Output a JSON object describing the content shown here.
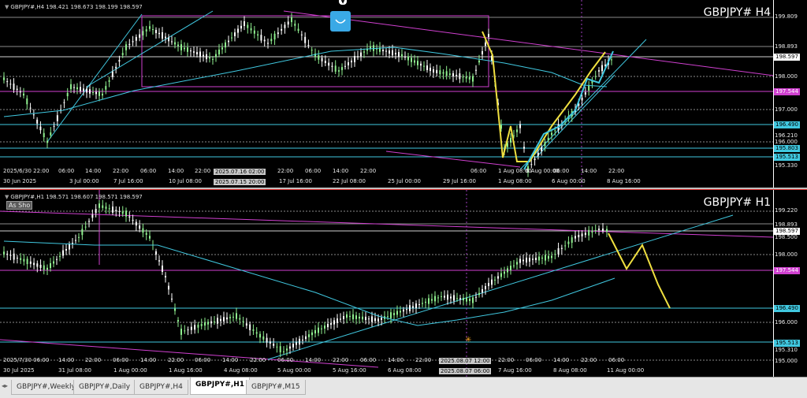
{
  "h4": {
    "info": "GBPJPY#,H4  198.421 198.673 198.199 198.597",
    "tf": "GBPJPY# H4",
    "prices": [
      "199.809",
      "198.893",
      "198.597",
      "198.000",
      "197.544",
      "197.000",
      "196.490",
      "196.210",
      "196.000",
      "195.803",
      "195.513",
      "195.330"
    ],
    "times": [
      "2025/6/30 22:00",
      "06:00",
      "14:00",
      "22:00",
      "06:00",
      "14:00",
      "22:00",
      "2025.07.16 02:00",
      "22:00",
      "06:00",
      "14:00",
      "22:00",
      "06:00",
      "1 Aug 08:00",
      "6 Aug 00:00",
      "06:00",
      "14:00",
      "22:00"
    ],
    "time_labels": [
      "30 Jun 2025",
      "3 Jul 00:00",
      "7 Jul 16:00",
      "10 Jul 08:00",
      "2025.07.15 20:00",
      "17 Jul 16:00",
      "22 Jul 08:00",
      "25 Jul 00:00",
      "29 Jul 16:00",
      "1 Aug 08:00",
      "6 Aug 00:00",
      "8 Aug 16:00"
    ]
  },
  "h1": {
    "info": "GBPJPY#,H1  198.571 198.607 198.571 198.597",
    "tf": "GBPJPY# H1",
    "as_show": "As Sho",
    "prices": [
      "199.220",
      "198.893",
      "198.597",
      "198.500",
      "198.000",
      "197.544",
      "196.490",
      "196.000",
      "195.513",
      "195.310",
      "195.000"
    ],
    "times": [
      "2025/7/30 06:00",
      "14:00",
      "22:00",
      "06:00",
      "14:00",
      "22:00",
      "06:00",
      "14:00",
      "22:00",
      "06:00",
      "14:00",
      "22:00",
      "06:00",
      "14:00",
      "22:00",
      "2025.08.07 12:00",
      "22:00",
      "06:00",
      "14:00",
      "22:00",
      "06:00"
    ],
    "time_labels": [
      "30 Jul 2025",
      "31 Jul 08:00",
      "1 Aug 00:00",
      "1 Aug 16:00",
      "4 Aug 08:00",
      "5 Aug 00:00",
      "5 Aug 16:00",
      "6 Aug 08:00",
      "2025.08.07 06:00",
      "7 Aug 16:00",
      "8 Aug 08:00",
      "11 Aug 00:00"
    ]
  },
  "tabs": [
    "GBPJPY#,Weekly",
    "GBPJPY#,Daily",
    "GBPJPY#,H4",
    "GBPJPY#,H1",
    "GBPJPY#,M15"
  ],
  "active_tab": "GBPJPY#,H1",
  "colors": {
    "cyan": "#40c8e0",
    "magenta": "#d040d0",
    "yellow": "#f0e040",
    "candle": "#90f090"
  }
}
